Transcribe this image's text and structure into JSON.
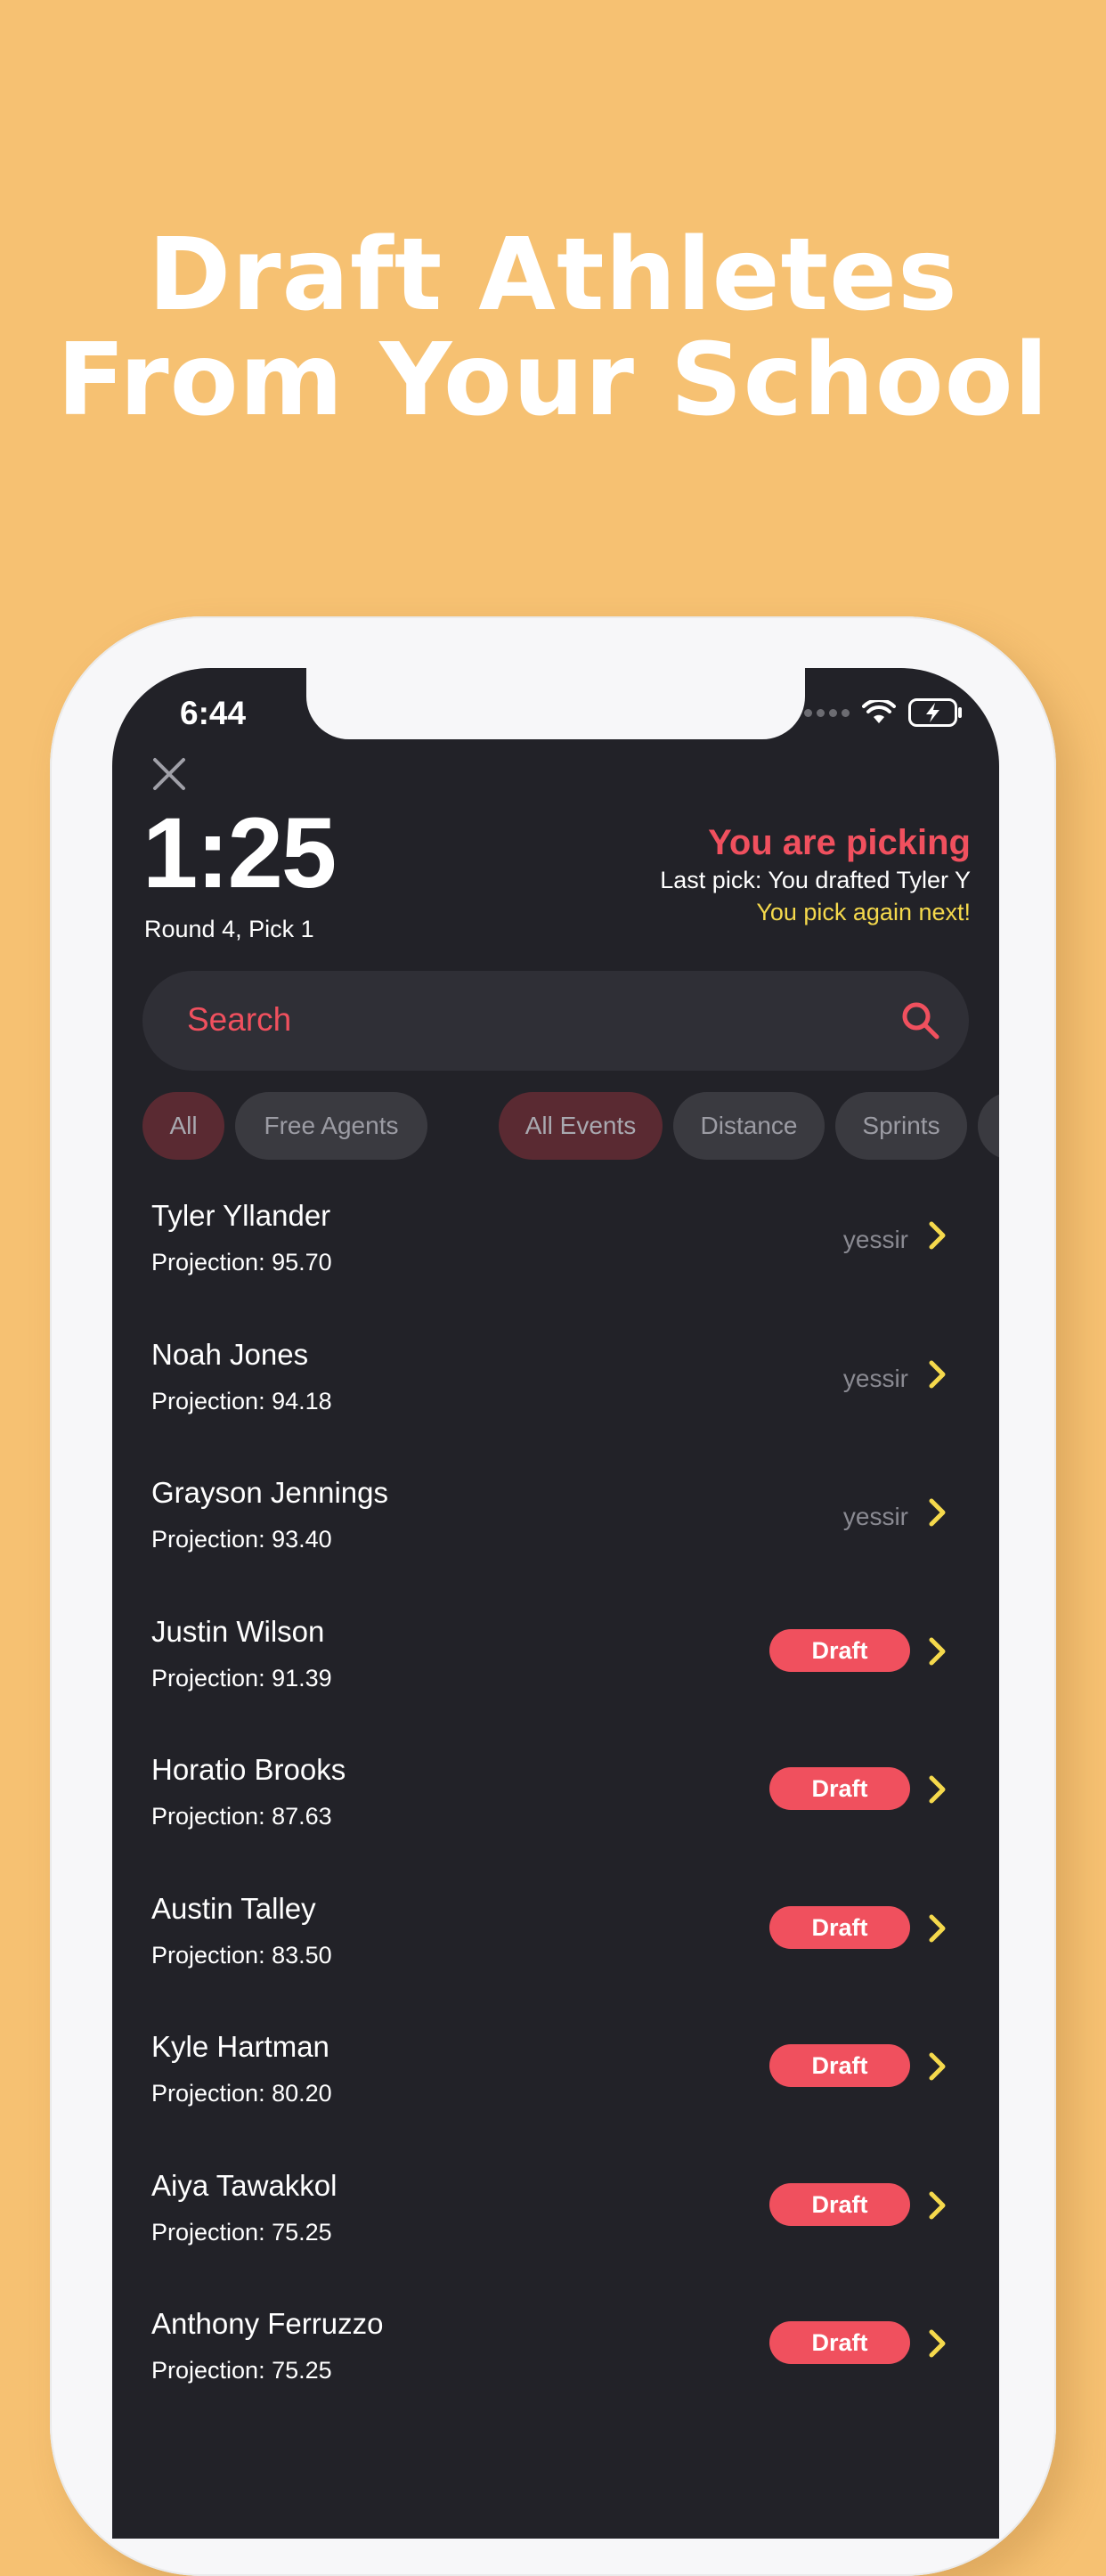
{
  "headline": {
    "line1": "Draft Athletes",
    "line2": "From Your School"
  },
  "status_bar": {
    "time": "6:44"
  },
  "draft": {
    "timer": "1:25",
    "round_info": "Round 4, Pick 1",
    "picking_title": "You are picking",
    "last_pick": "Last pick: You drafted Tyler Y",
    "pick_next": "You pick again next!"
  },
  "search": {
    "placeholder": "Search"
  },
  "filters": {
    "all": "All",
    "free_agents": "Free Agents",
    "all_events": "All Events",
    "distance": "Distance",
    "sprints": "Sprints"
  },
  "athletes": [
    {
      "name": "Tyler Yllander",
      "projection": "Projection: 95.70",
      "status": "yessir",
      "draft_label": ""
    },
    {
      "name": "Noah Jones",
      "projection": "Projection: 94.18",
      "status": "yessir",
      "draft_label": ""
    },
    {
      "name": "Grayson Jennings",
      "projection": "Projection: 93.40",
      "status": "yessir",
      "draft_label": ""
    },
    {
      "name": "Justin Wilson",
      "projection": "Projection: 91.39",
      "status": "",
      "draft_label": "Draft"
    },
    {
      "name": "Horatio Brooks",
      "projection": "Projection: 87.63",
      "status": "",
      "draft_label": "Draft"
    },
    {
      "name": "Austin Talley",
      "projection": "Projection: 83.50",
      "status": "",
      "draft_label": "Draft"
    },
    {
      "name": "Kyle Hartman",
      "projection": "Projection: 80.20",
      "status": "",
      "draft_label": "Draft"
    },
    {
      "name": "Aiya Tawakkol",
      "projection": "Projection: 75.25",
      "status": "",
      "draft_label": "Draft"
    },
    {
      "name": "Anthony Ferruzzo",
      "projection": "Projection: 75.25",
      "status": "",
      "draft_label": "Draft"
    }
  ],
  "colors": {
    "background": "#F6C172",
    "screen": "#222228",
    "accent_red": "#F0505E",
    "accent_yellow": "#F5D94C"
  },
  "icons": [
    "close-icon",
    "search-icon",
    "chevron-right-icon",
    "wifi-icon",
    "battery-charging-icon"
  ]
}
